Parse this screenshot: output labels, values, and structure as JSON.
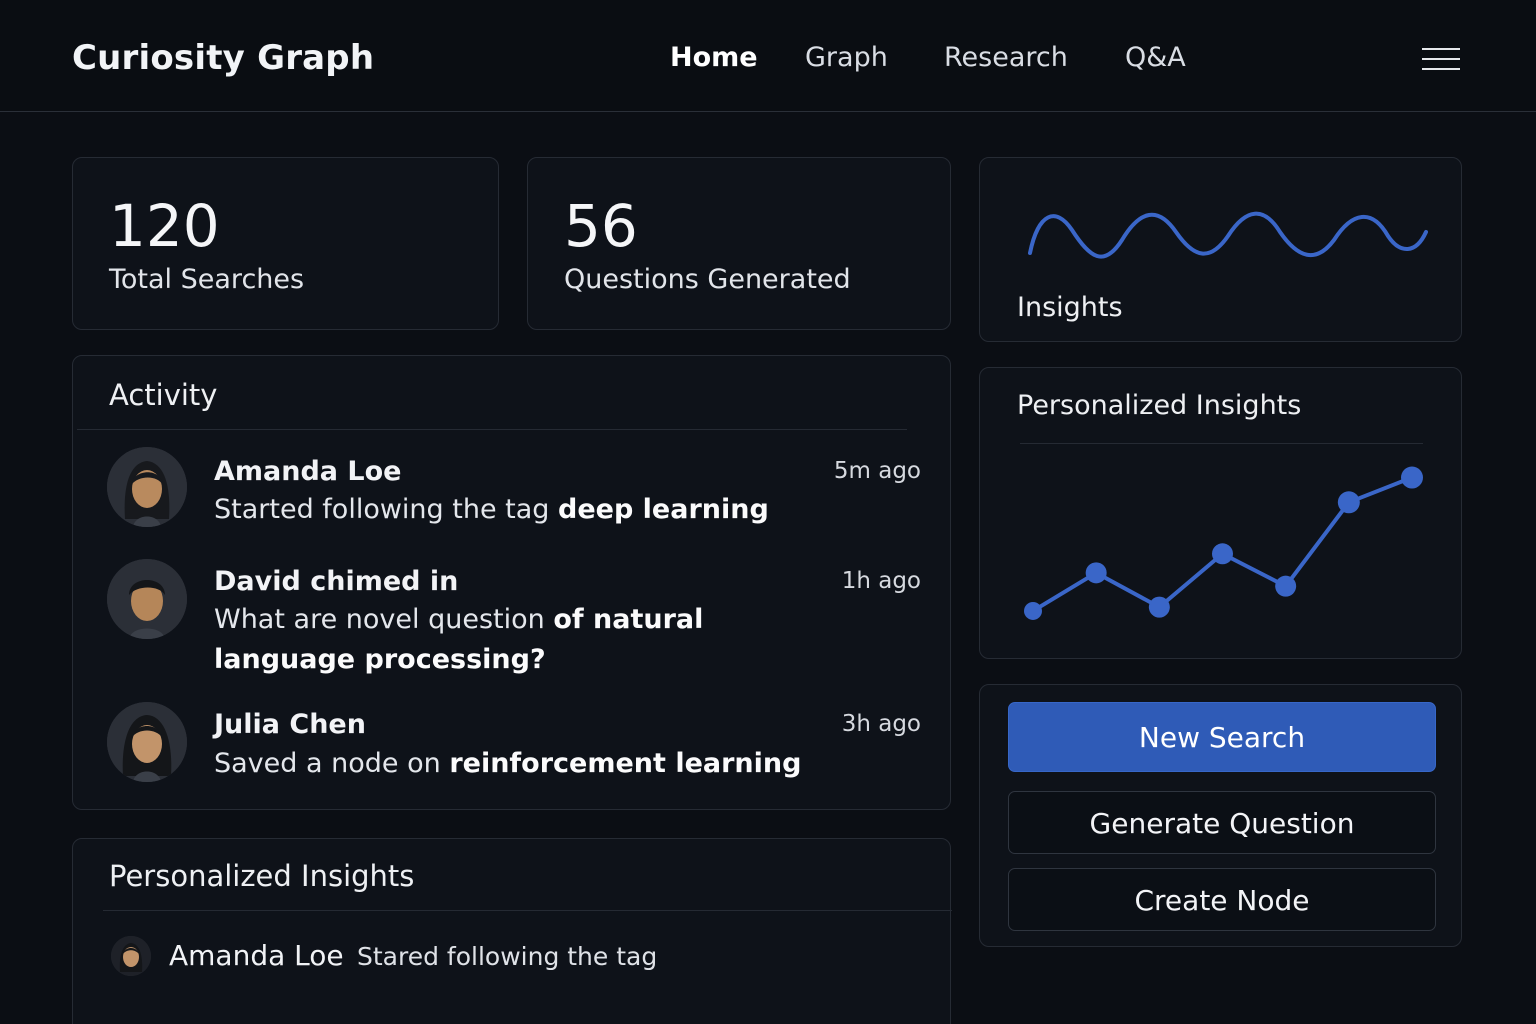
{
  "app": {
    "title": "Curiosity Graph"
  },
  "nav": {
    "items": [
      {
        "label": "Home",
        "active": true
      },
      {
        "label": "Graph",
        "active": false
      },
      {
        "label": "Research",
        "active": false
      },
      {
        "label": "Q&A",
        "active": false
      }
    ],
    "menu_icon": "hamburger-menu-icon"
  },
  "stats": {
    "total_searches": {
      "value": "120",
      "label": "Total Searches"
    },
    "questions_generated": {
      "value": "56",
      "label": "Questions Generated"
    }
  },
  "insights_card": {
    "title": "Insights"
  },
  "activity": {
    "title": "Activity",
    "items": [
      {
        "name": "Amanda Loe",
        "text_pre": "Started following the tag ",
        "text_bold": "deep learning",
        "time": "5m ago"
      },
      {
        "name": "David chimed in",
        "text_pre": "What are novel question ",
        "text_bold": "of natural language processing?",
        "time": "1h ago"
      },
      {
        "name": "Julia Chen",
        "text_pre": "Saved a node on ",
        "text_bold": "reinforcement learning",
        "time": "3h ago"
      }
    ]
  },
  "personalized_chart": {
    "title": "Personalized Insights"
  },
  "chart_data": {
    "type": "line",
    "title": "Personalized Insights",
    "x": [
      1,
      2,
      3,
      4,
      5,
      6,
      7
    ],
    "series": [
      {
        "values": [
          1,
          3,
          1.2,
          4,
          2.3,
          6.7,
          8
        ]
      }
    ],
    "ylim": [
      0,
      8.5
    ],
    "grid": false,
    "color": "#3a66c8"
  },
  "personalized_list": {
    "title": "Personalized Insights",
    "items": [
      {
        "name": "Amanda Loe",
        "text": "Stared following the tag"
      }
    ]
  },
  "actions": {
    "new_search": "New Search",
    "generate_question": "Generate Question",
    "create_node": "Create Node"
  },
  "colors": {
    "accent": "#2f5bb7",
    "background": "#0b0e14",
    "card": "#0e1219",
    "line": "#3a66c8"
  }
}
